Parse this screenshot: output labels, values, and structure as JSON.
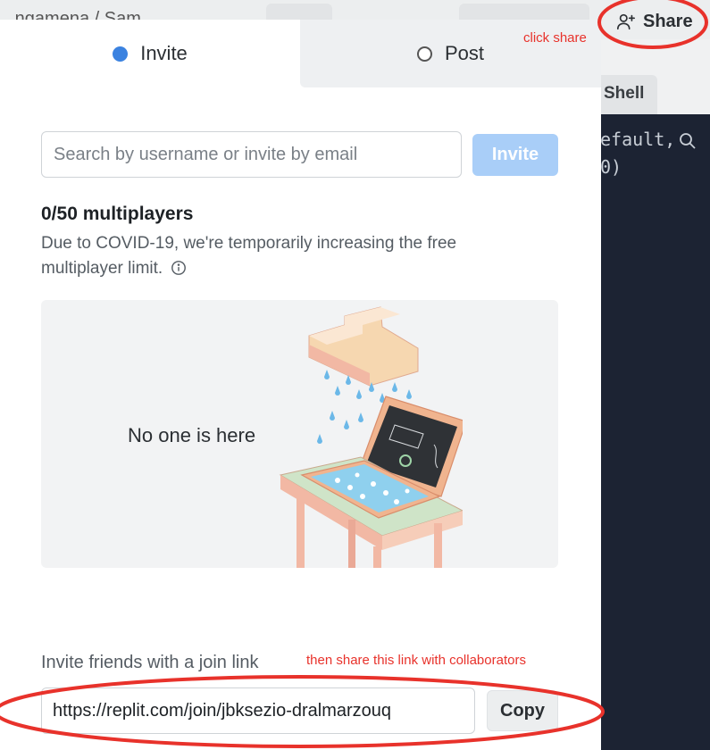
{
  "background": {
    "breadcrumb": "...ngamena / Sam",
    "share_label": "Share",
    "shell_tab_label": "Shell",
    "console_lines": [
      "efault,",
      "0)"
    ]
  },
  "modal": {
    "tabs": [
      {
        "label": "Invite",
        "selected": true
      },
      {
        "label": "Post",
        "selected": false
      }
    ],
    "search": {
      "placeholder": "Search by username or invite by email",
      "value": ""
    },
    "invite_button": "Invite",
    "multiplayer_count": "0/50 multiplayers",
    "multiplayer_note": "Due to COVID-19, we're temporarily increasing the free multiplayer limit.",
    "empty_state": "No one is here",
    "join_link_label": "Invite friends with a join link",
    "join_link_value": "https://replit.com/join/jbksezio-dralmarzouq",
    "copy_button": "Copy"
  },
  "annotations": {
    "click_share": "click share",
    "share_link": "then share this link with collaborators",
    "color": "#e8322b"
  },
  "icons": [
    "add-user-icon",
    "info-icon",
    "search-icon",
    "radio-selected-icon",
    "radio-unselected-icon"
  ],
  "colors": {
    "accent": "#3b82e0",
    "invite_button_disabled": "#a9cef8",
    "console_bg": "#1c2333"
  }
}
